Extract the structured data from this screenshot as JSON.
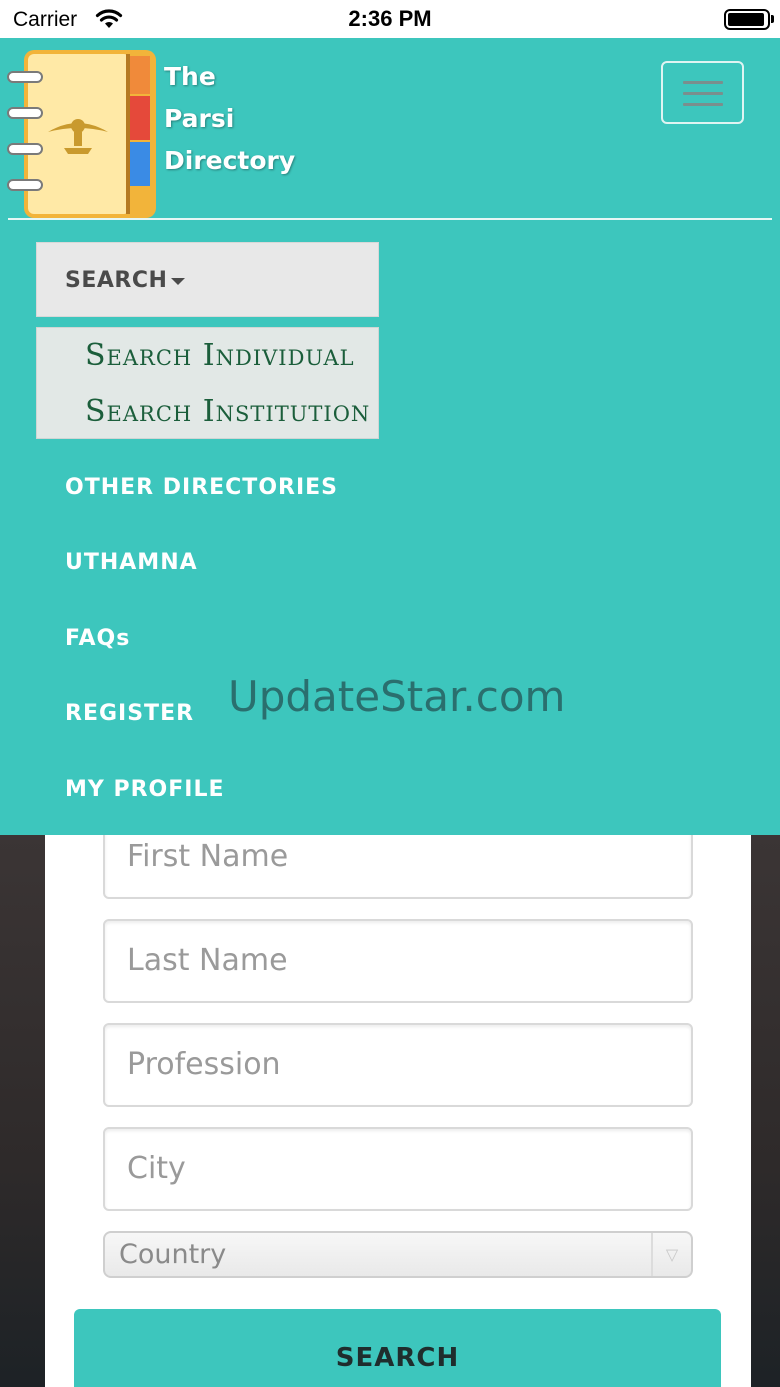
{
  "status_bar": {
    "carrier": "Carrier",
    "time": "2:36 PM"
  },
  "header": {
    "brand_line1": "The",
    "brand_line2": "Parsi",
    "brand_line3": "Directory",
    "menu_icon": "hamburger-menu-icon"
  },
  "nav": {
    "search_label": "SEARCH",
    "search_dropdown": [
      "Search Individual",
      "Search Institution"
    ],
    "links": [
      "OTHER DIRECTORIES",
      "UTHAMNA",
      "FAQs",
      "REGISTER",
      "MY PROFILE"
    ]
  },
  "watermark": "UpdateStar.com",
  "form": {
    "first_name_placeholder": "First Name",
    "last_name_placeholder": "Last Name",
    "profession_placeholder": "Profession",
    "city_placeholder": "City",
    "country_placeholder": "Country",
    "submit_label": "SEARCH"
  },
  "colors": {
    "nav_teal": "#3dc6bd",
    "dropdown_text": "#1b5e3b",
    "watermark": "#2a6b6a"
  }
}
